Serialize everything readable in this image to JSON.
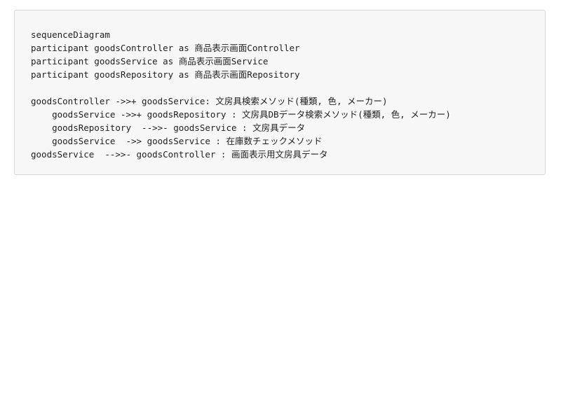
{
  "code_block": {
    "lines": [
      "sequenceDiagram",
      "participant goodsController as 商品表示画面Controller",
      "participant goodsService as 商品表示画面Service",
      "participant goodsRepository as 商品表示画面Repository",
      "",
      "goodsController ->>+ goodsService: 文房具検索メソッド(種類, 色, メーカー)",
      "    goodsService ->>+ goodsRepository : 文房具DBデータ検索メソッド(種類, 色, メーカー)",
      "    goodsRepository  -->>- goodsService : 文房具データ",
      "    goodsService  ->> goodsService : 在庫数チェックメソッド",
      "goodsService  -->>- goodsController : 画面表示用文房具データ"
    ]
  }
}
